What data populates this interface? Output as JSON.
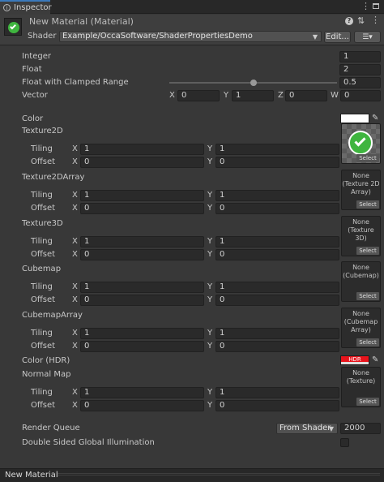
{
  "tab": {
    "title": "Inspector"
  },
  "header": {
    "material_name": "New Material (Material)",
    "shader_label": "Shader",
    "shader_value": "Example/OccaSoftware/ShaderPropertiesDemo",
    "edit_label": "Edit..."
  },
  "props": {
    "integer": {
      "label": "Integer",
      "value": "1"
    },
    "float": {
      "label": "Float",
      "value": "2"
    },
    "float_range": {
      "label": "Float with Clamped Range",
      "value": "0.5",
      "fraction": 0.5
    },
    "vector": {
      "label": "Vector",
      "x": "0",
      "y": "1",
      "z": "0",
      "w": "0",
      "axis_x": "X",
      "axis_y": "Y",
      "axis_z": "Z",
      "axis_w": "W"
    },
    "color": {
      "label": "Color",
      "swatch": "#ffffff"
    },
    "color_hdr": {
      "label": "Color (HDR)",
      "swatch": "#e8141c",
      "badge": "HDR"
    }
  },
  "textures": {
    "tiling_label": "Tiling",
    "offset_label": "Offset",
    "axis_x": "X",
    "axis_y": "Y",
    "select_label": "Select",
    "items": [
      {
        "label": "Texture2D",
        "tiling_x": "1",
        "tiling_y": "1",
        "offset_x": "0",
        "offset_y": "0",
        "preview": "checkmark"
      },
      {
        "label": "Texture2DArray",
        "tiling_x": "1",
        "tiling_y": "1",
        "offset_x": "0",
        "offset_y": "0",
        "none_text": "None\n(Texture 2D\nArray)"
      },
      {
        "label": "Texture3D",
        "tiling_x": "1",
        "tiling_y": "1",
        "offset_x": "0",
        "offset_y": "0",
        "none_text": "None\n(Texture 3D)"
      },
      {
        "label": "Cubemap",
        "tiling_x": "1",
        "tiling_y": "1",
        "offset_x": "0",
        "offset_y": "0",
        "none_text": "None\n(Cubemap)"
      },
      {
        "label": "CubemapArray",
        "tiling_x": "1",
        "tiling_y": "1",
        "offset_x": "0",
        "offset_y": "0",
        "none_text": "None\n(Cubemap\nArray)"
      },
      {
        "label": "Normal Map",
        "tiling_x": "1",
        "tiling_y": "1",
        "offset_x": "0",
        "offset_y": "0",
        "none_text": "None\n(Texture)"
      }
    ]
  },
  "render_queue": {
    "label": "Render Queue",
    "dropdown": "From Shader",
    "value": "2000"
  },
  "double_sided_gi": {
    "label": "Double Sided Global Illumination",
    "checked": false
  },
  "footer": {
    "title": "New Material"
  },
  "colors": {
    "accent_green": "#3fb53f",
    "hdr_red": "#e8141c"
  }
}
